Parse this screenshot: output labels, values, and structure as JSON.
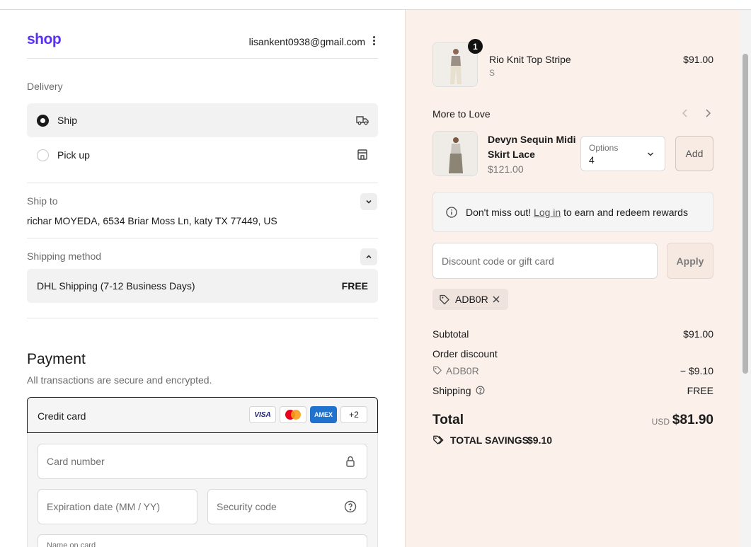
{
  "header": {
    "logo": "shop",
    "email": "lisankent0938@gmail.com"
  },
  "delivery": {
    "label": "Delivery",
    "options": [
      {
        "label": "Ship",
        "selected": true,
        "icon": "truck-icon"
      },
      {
        "label": "Pick up",
        "selected": false,
        "icon": "store-icon"
      }
    ]
  },
  "ship_to": {
    "label": "Ship to",
    "value": "richar MOYEDA, 6534 Briar Moss Ln, katy TX 77449, US"
  },
  "shipping_method": {
    "label": "Shipping method",
    "name": "DHL Shipping (7-12 Business Days)",
    "price": "FREE"
  },
  "payment": {
    "title": "Payment",
    "subtitle": "All transactions are secure and encrypted.",
    "method_label": "Credit card",
    "cards": [
      "VISA",
      "mastercard",
      "AMEX",
      "+2"
    ],
    "fields": {
      "card_number": "Card number",
      "expiration": "Expiration date (MM / YY)",
      "security": "Security code",
      "name": "Name on card"
    }
  },
  "cart": {
    "item": {
      "name": "Rio Knit Top Stripe",
      "variant": "S",
      "price": "$91.00",
      "quantity": "1"
    },
    "more_to_love": {
      "title": "More to Love",
      "item_name": "Devyn Sequin Midi Skirt Lace",
      "item_price": "$121.00",
      "options_label": "Options",
      "options_value": "4",
      "add_label": "Add"
    },
    "rewards": {
      "prefix": "Don't miss out!",
      "link": "Log in",
      "suffix": "to earn and redeem rewards"
    },
    "discount": {
      "placeholder": "Discount code or gift card",
      "apply": "Apply",
      "applied_code": "ADB0R"
    },
    "summary": {
      "subtotal_label": "Subtotal",
      "subtotal": "$91.00",
      "order_discount_label": "Order discount",
      "discount_code": "ADB0R",
      "discount_value": "− $9.10",
      "shipping_label": "Shipping",
      "shipping_value": "FREE",
      "total_label": "Total",
      "currency": "USD",
      "total": "$81.90",
      "savings_label": "TOTAL SAVINGS",
      "savings": "$9.10"
    }
  },
  "colors": {
    "brand": "#5a31f4",
    "sidebar_bg": "#fbf0ea",
    "amex": "#1f72cd"
  }
}
